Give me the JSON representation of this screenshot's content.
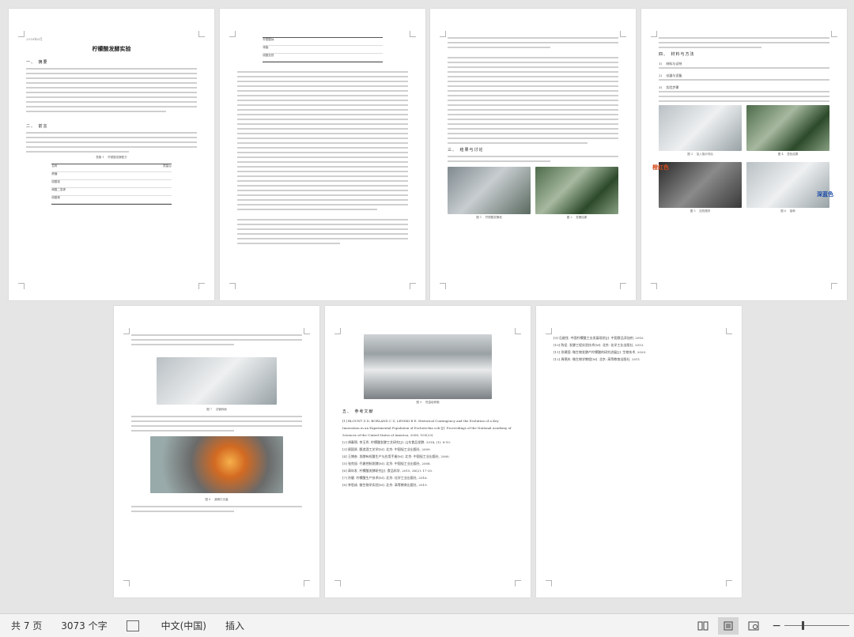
{
  "document": {
    "title": "柠檬酸发酵实验",
    "page1": {
      "header": "2018年6月",
      "section1": "一、　摘要",
      "section2": "二、　前言",
      "table_caption": "表格 1 　柠檬酸发酵配方",
      "table_col1": "名称",
      "table_col2": "质量/g",
      "table_rows": [
        "蔗糖",
        "硫酸铵",
        "磷酸二氢钾",
        "硫酸镁"
      ]
    },
    "page2": {
      "rows": [
        "柠檬酸钠",
        "琼脂",
        "硫酸亚铁"
      ]
    },
    "page3": {
      "section": "三、　结果与讨论",
      "cap1": "图 1 　柠檬酸发酵液",
      "cap2": "图 2 　发酵结果"
    },
    "page4": {
      "section": "四、　材料与方法",
      "annot_red": "橙红色",
      "annot_blue": "深蓝色",
      "cap1": "图 3 　加入指示剂后",
      "cap2": "图 4 　显色结果",
      "cap3": "图 5 　加热搅拌",
      "cap4": "图 6 　接种",
      "items": [
        "1) 　材料与试剂",
        "2) 　仪器与设备",
        "3) 　实验步骤"
      ]
    },
    "page5": {
      "cap1": "图 7 　试管斜面",
      "cap2": "图 8 　酒精灯灭菌"
    },
    "page6": {
      "cap1": "图 9 　恒温培养箱",
      "section": "五、　参考文献",
      "refs": [
        "[1] BLOUNT Z D, BORLAND C Z, LENSKI R E. Historical Contingency and the Evolution of a Key Innovation in an Experimental Population of Escherichia coli [J]. Proceedings of the National Academy of Sciences of the United States of America, 2008, 105(23).",
        "[2] 胡春锦, 李玉秀. 柠檬酸发酵工艺研究[J]. 山东食品发酵, 2014, (1): 8-10.",
        "[3] 顾国贤. 酿造酒工艺学[M]. 北京: 中国轻工业出版社, 2009.",
        "[4] 王博彦. 发酵有机酸生产与应用手册[M]. 北京: 中国轻工业出版社, 2000.",
        "[5] 张克旭. 代谢控制发酵[M]. 北京: 中国轻工业出版社, 2008.",
        "[6] 高年发. 柠檬酸发酵研究[J]. 食品科学, 2015, 36(2): 17-20.",
        "[7] 孙健. 柠檬酸生产技术[M]. 北京: 化学工业出版社, 2016.",
        "[8] 李思成. 微生物学实验[M]. 北京: 高等教育出版社, 2019."
      ]
    },
    "page7": {
      "refs": [
        "[9] 石维忱. 中国柠檬酸工业发展现状[J]. 中国食品添加剂, 2010.",
        "[10] 陈坚. 发酵工程实验技术[M]. 北京: 化学工业出版社, 2013.",
        "[11] 徐建国. 微生物发酵产柠檬酸的研究进展[J]. 生物技术, 2020.",
        "[12] 周德庆. 微生物学教程[M]. 北京: 高等教育出版社, 2011."
      ]
    }
  },
  "status_bar": {
    "pages": "共 7 页",
    "word_count": "3073 个字",
    "language": "中文(中国)",
    "mode": "插入",
    "icons": [
      "proofing-icon",
      "read-mode-icon",
      "print-layout-icon",
      "web-layout-icon"
    ]
  }
}
